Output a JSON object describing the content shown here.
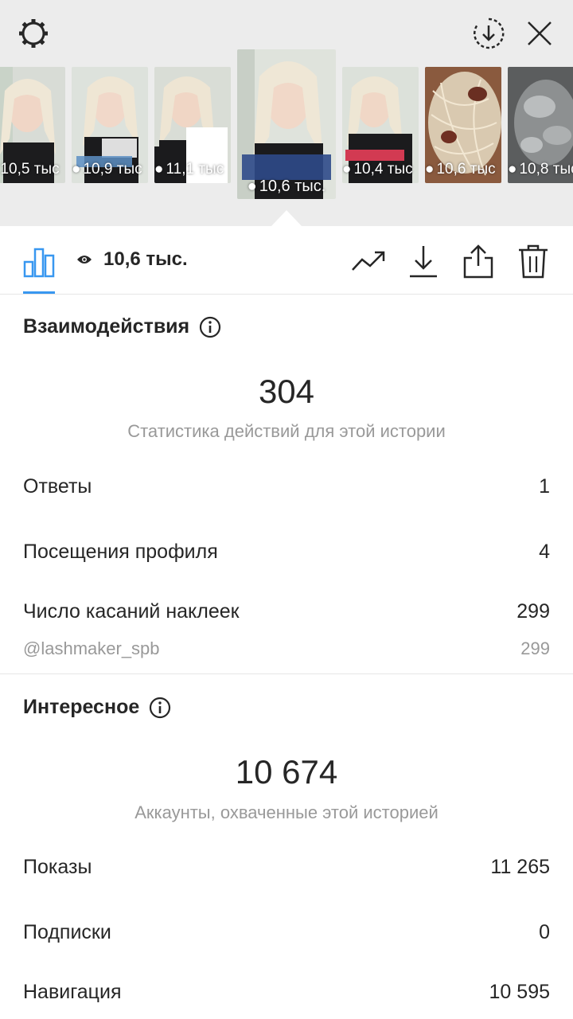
{
  "stories": [
    {
      "views": "10,5 тыс"
    },
    {
      "views": "10,9 тыс"
    },
    {
      "views": "11,1 тыс"
    },
    {
      "views": "10,6 тыс.",
      "active": true
    },
    {
      "views": "10,4 тыс"
    },
    {
      "views": "10,6 тыс"
    },
    {
      "views": "10,8 тыс"
    }
  ],
  "toolbar": {
    "views": "10,6 тыс."
  },
  "interactions": {
    "title": "Взаимодействия",
    "total": "304",
    "subtitle": "Статистика действий для этой истории",
    "rows": [
      {
        "label": "Ответы",
        "value": "1"
      },
      {
        "label": "Посещения профиля",
        "value": "4"
      },
      {
        "label": "Число касаний наклеек",
        "value": "299"
      }
    ],
    "sticker": {
      "label": "@lashmaker_spb",
      "value": "299"
    }
  },
  "discovery": {
    "title": "Интересное",
    "total": "10 674",
    "subtitle": "Аккаунты, охваченные этой историей",
    "rows": [
      {
        "label": "Показы",
        "value": "11 265"
      },
      {
        "label": "Подписки",
        "value": "0"
      },
      {
        "label": "Навигация",
        "value": "10 595"
      }
    ]
  },
  "colors": {
    "accent": "#3897f0",
    "text": "#262626",
    "muted": "#999999",
    "top_bg": "#ececec"
  },
  "icons": [
    "gear-icon",
    "download-circle-icon",
    "close-icon",
    "bar-chart-icon",
    "eye-icon",
    "trend-icon",
    "download-icon",
    "share-icon",
    "trash-icon",
    "info-icon"
  ]
}
